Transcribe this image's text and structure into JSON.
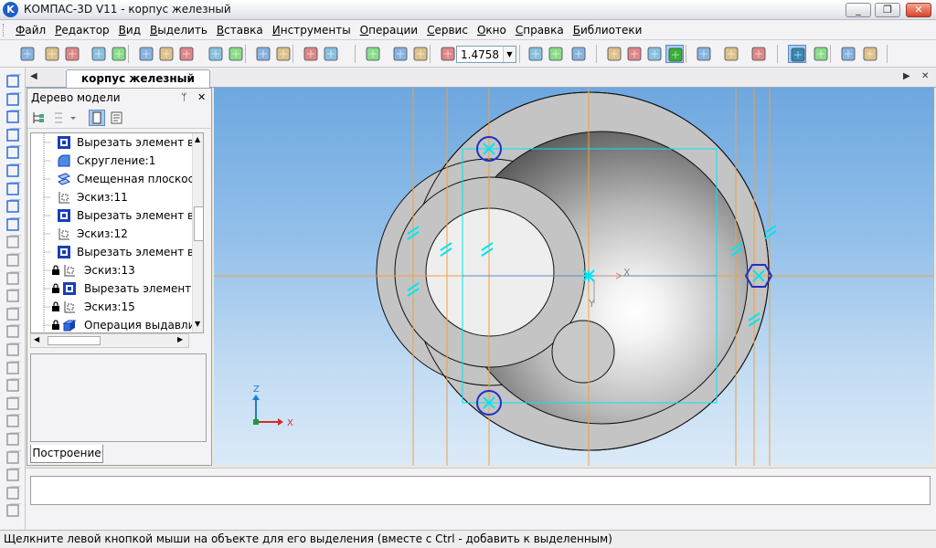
{
  "window": {
    "title": "КОМПАС-3D V11 - корпус железный",
    "minimize": "_",
    "restore": "❐",
    "close": "✕",
    "app_icon": "K"
  },
  "menu": [
    "Файл",
    "Редактор",
    "Вид",
    "Выделить",
    "Вставка",
    "Инструменты",
    "Операции",
    "Сервис",
    "Окно",
    "Справка",
    "Библиотеки"
  ],
  "toolbar": {
    "zoom_value": "1.4758",
    "icons": [
      "new-icon",
      "open-icon",
      "save-icon",
      "preview-icon",
      "print-icon",
      "cut-icon",
      "copy-icon",
      "paste-icon",
      "format-brush-icon",
      "properties-icon",
      "undo-icon",
      "redo-icon",
      "manager-icon",
      "library-icon",
      "zoom-fit-icon",
      "zoom-in-icon",
      "zoom-window-icon",
      "zoom-scale-icon",
      "pan-icon",
      "rotate-icon",
      "orientation-icon",
      "wireframe-icon",
      "hidden-lines-icon",
      "hidden-lines-thin-icon",
      "shaded-icon",
      "shaded-edges-icon",
      "perspective-icon",
      "filter-icon",
      "tree-icon",
      "snap-icon",
      "view-manager-icon",
      "refresh-icon"
    ]
  },
  "document": {
    "tab_title": "корпус железный"
  },
  "tree": {
    "title": "Дерево модели",
    "pin": "ᛘ",
    "close": "✕",
    "bottom_tab": "Построение",
    "items": [
      {
        "label": "Вырезать элемент вы",
        "icon": "cut-extrude-icon",
        "locked": false
      },
      {
        "label": "Скругление:1",
        "icon": "fillet-icon",
        "locked": false
      },
      {
        "label": "Смещенная плоскост",
        "icon": "offset-plane-icon",
        "locked": false
      },
      {
        "label": "Эскиз:11",
        "icon": "sketch-icon",
        "locked": false
      },
      {
        "label": "Вырезать элемент вы",
        "icon": "cut-extrude-icon",
        "locked": false
      },
      {
        "label": "Эскиз:12",
        "icon": "sketch-icon",
        "locked": false
      },
      {
        "label": "Вырезать элемент вы",
        "icon": "cut-extrude-icon",
        "locked": false
      },
      {
        "label": "Эскиз:13",
        "icon": "sketch-icon",
        "locked": true
      },
      {
        "label": "Вырезать элемент в",
        "icon": "cut-extrude-icon",
        "locked": true
      },
      {
        "label": "Эскиз:15",
        "icon": "sketch-icon",
        "locked": true
      },
      {
        "label": "Операция выдавлив",
        "icon": "extrude-icon",
        "locked": true
      }
    ]
  },
  "viewport": {
    "axis_labels": {
      "x": "X",
      "y": "Y",
      "z": "Z"
    },
    "triad_labels": {
      "x": "X",
      "z": "Z"
    }
  },
  "status": {
    "text": "Щелкните левой кнопкой мыши на объекте для его выделения (вместе с Ctrl - добавить к выделенным)"
  },
  "colors": {
    "accent": "#1e5fc8",
    "sketch_cyan": "#00e5f5",
    "constraint_blue": "#1a33c9",
    "axis_orange": "#f0a040"
  }
}
